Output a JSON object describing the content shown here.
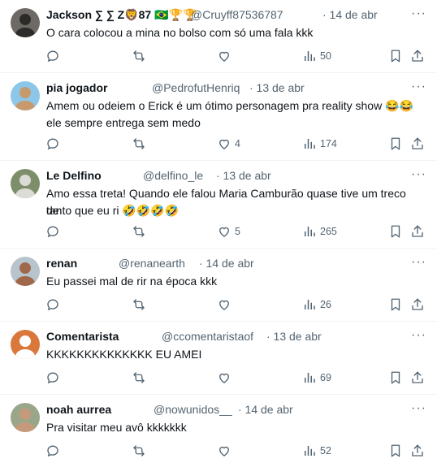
{
  "tweets": [
    {
      "name": "Jackson ∑ ∑ Z🦁87 🇧🇷🏆🏆",
      "handle": "@Cruyff87536787",
      "date": "· 14 de abr",
      "lines": [
        "O cara colocou a mina no bolso com só uma fala kkk"
      ],
      "likes": "",
      "views": "50",
      "avatar_colors": [
        "#6d6a66",
        "#2c2b2a"
      ]
    },
    {
      "name": "pia jogador",
      "handle": "@PedrofutHenriq",
      "date": "· 13 de abr",
      "lines": [
        "Amem ou odeiem o Erick é um ótimo personagem pra reality show 😂😂",
        "ele sempre entrega sem medo"
      ],
      "likes": "4",
      "views": "174",
      "avatar_colors": [
        "#8cc6e8",
        "#c79a6e"
      ]
    },
    {
      "name": "Le Delfino",
      "handle": "@delfino_le",
      "date": "· 13 de abr",
      "lines": [
        "Amo essa treta! Quando ele falou Maria Camburão quase tive um treco de",
        "tanto que eu ri 🤣🤣🤣🤣"
      ],
      "likes": "5",
      "views": "265",
      "avatar_colors": [
        "#7d8f6a",
        "#dcdcd6"
      ]
    },
    {
      "name": "renan",
      "handle": "@renanearth",
      "date": "· 14 de abr",
      "lines": [
        "Eu passei mal de rir na época kkk"
      ],
      "likes": "",
      "views": "26",
      "avatar_colors": [
        "#b8c4cc",
        "#a0684a"
      ]
    },
    {
      "name": "Comentarista",
      "handle": "@ccomentaristaof",
      "date": "· 13 de abr",
      "lines": [
        "KKKKKKKKKKKKKK EU AMEI"
      ],
      "likes": "",
      "views": "69",
      "avatar_colors": [
        "#d9783a",
        "#ffffff"
      ]
    },
    {
      "name": "noah aurrea",
      "handle": "@nowunidos__",
      "date": "· 14 de abr",
      "lines": [
        "Pra visitar meu avô kkkkkkk"
      ],
      "likes": "",
      "views": "52",
      "avatar_colors": [
        "#9aa68a",
        "#c59a7a"
      ]
    }
  ],
  "icons": {
    "more": "more-options-icon",
    "reply": "reply-icon",
    "retweet": "retweet-icon",
    "like": "like-icon",
    "views": "views-icon",
    "bookmark": "bookmark-icon",
    "share": "share-icon"
  },
  "colors": {
    "text": "#0f1419",
    "secondary": "#536471",
    "divider": "#eff3f4"
  }
}
